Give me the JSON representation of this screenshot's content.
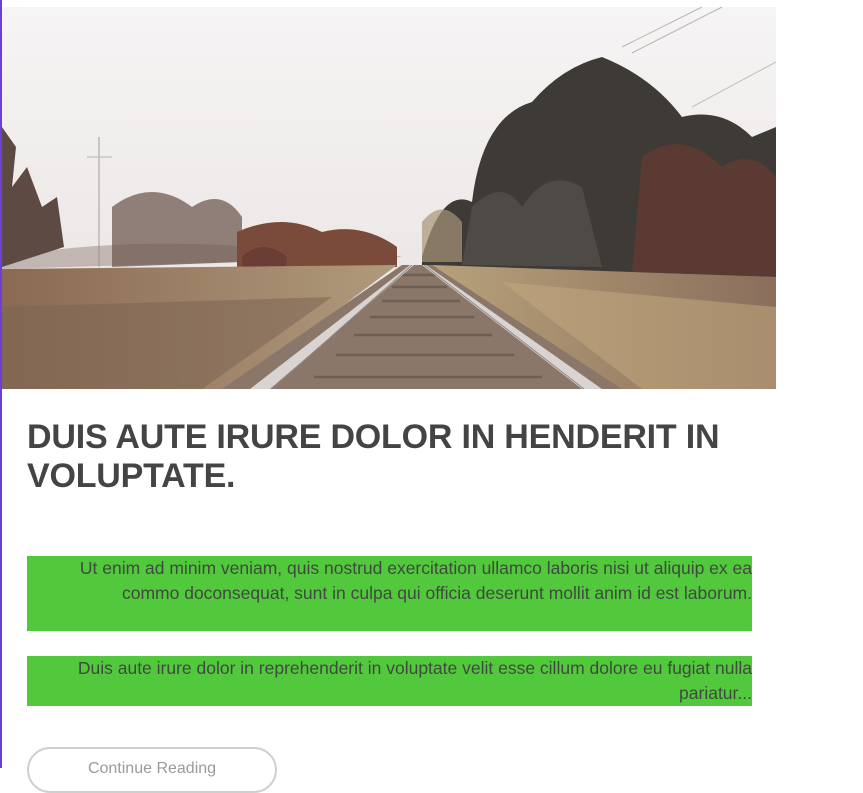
{
  "post": {
    "image_alt": "",
    "title": "DUIS AUTE IRURE DOLOR IN HENDERIT IN VOLUPTATE.",
    "paragraphs": [
      "Ut enim ad minim veniam, quis nostrud exercitation ullamco laboris nisi ut aliquip ex ea commo doconsequat, sunt in culpa qui officia deserunt mollit anim id est laborum.",
      "Duis aute irure dolor in reprehenderit in voluptate velit esse cillum dolore eu fugiat nulla pariatur..."
    ],
    "read_more_label": "Continue Reading"
  },
  "colors": {
    "accent_left": "#6d3fd8",
    "paragraph_highlight": "#52c83c",
    "title_text": "#444444",
    "button_border": "#cfcfcf"
  }
}
